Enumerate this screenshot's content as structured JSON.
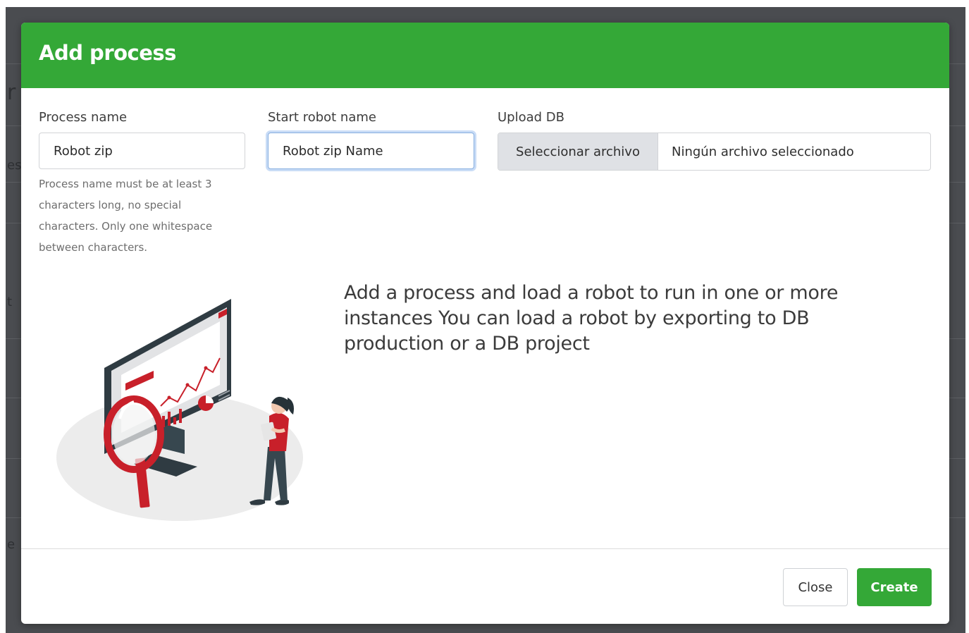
{
  "modal": {
    "title": "Add process",
    "fields": {
      "process_name": {
        "label": "Process name",
        "value": "Robot zip",
        "help": "Process name must be at least 3 characters long, no special characters. Only one whitespace between characters."
      },
      "start_robot_name": {
        "label": "Start robot name",
        "value": "Robot zip Name"
      },
      "upload_db": {
        "label": "Upload DB",
        "button_label": "Seleccionar archivo",
        "status": "Ningún archivo seleccionado"
      }
    },
    "description": "Add a process and load a robot to run in one or more instances You can load a robot by exporting to DB production or a DB project",
    "footer": {
      "close_label": "Close",
      "create_label": "Create"
    }
  },
  "colors": {
    "header_green": "#34a837",
    "accent_red": "#c8202a",
    "backdrop": "#4a4c50",
    "focus_border": "#86aee0"
  },
  "icons": {
    "illustration": "analytics-monitor-magnifier-person-illustration"
  }
}
